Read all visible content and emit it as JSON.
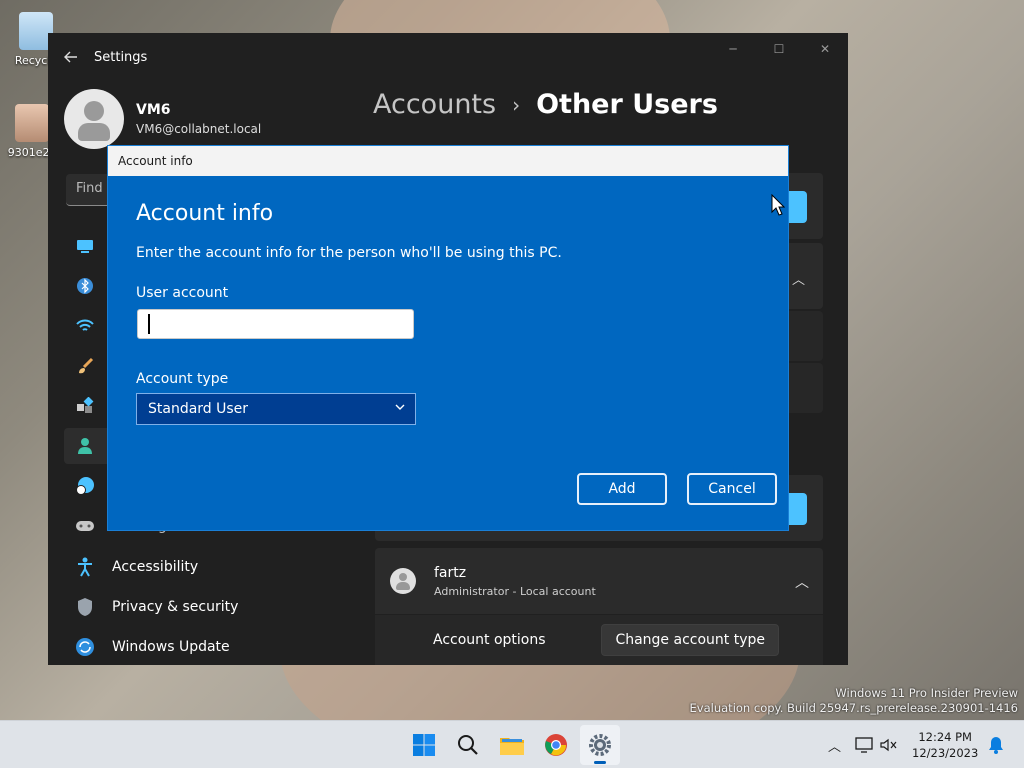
{
  "desktop": {
    "icons": [
      {
        "label": "Recycle"
      },
      {
        "label": "9301e2a"
      }
    ],
    "watermark": {
      "line1": "Windows 11 Pro Insider Preview",
      "line2": "Evaluation copy. Build 25947.rs_prerelease.230901-1416"
    }
  },
  "settings": {
    "title": "Settings",
    "profile": {
      "name": "VM6",
      "email": "VM6@collabnet.local"
    },
    "search": {
      "placeholder": "Find a"
    },
    "breadcrumb": {
      "parent": "Accounts",
      "separator": "›",
      "current": "Other Users"
    },
    "nav": [
      {
        "label": "",
        "icon": "system-icon"
      },
      {
        "label": "",
        "icon": "bluetooth-icon"
      },
      {
        "label": "",
        "icon": "wifi-icon"
      },
      {
        "label": "",
        "icon": "personalization-brush-icon"
      },
      {
        "label": "",
        "icon": "apps-icon"
      },
      {
        "label": "",
        "icon": "accounts-person-icon",
        "active": true
      },
      {
        "label": "",
        "icon": "time-language-icon"
      },
      {
        "label": "Gaming",
        "icon": "gamepad-icon"
      },
      {
        "label": "Accessibility",
        "icon": "accessibility-icon"
      },
      {
        "label": "Privacy & security",
        "icon": "shield-icon"
      },
      {
        "label": "Windows Update",
        "icon": "windows-update-icon"
      }
    ],
    "users": [
      {
        "name": "fartz",
        "detail": "Administrator - Local account",
        "options_label": "Account options",
        "change_button": "Change account type"
      }
    ]
  },
  "dialog": {
    "window_title": "Account info",
    "heading": "Account info",
    "description": "Enter the account info for the person who'll be using this PC.",
    "user_account_label": "User account",
    "user_account_value": "",
    "account_type_label": "Account type",
    "account_type_value": "Standard User",
    "add_button": "Add",
    "cancel_button": "Cancel"
  },
  "taskbar": {
    "apps": [
      "start-icon",
      "search-icon",
      "file-explorer-icon",
      "chrome-icon",
      "settings-icon"
    ],
    "active_app": "settings-icon",
    "clock": {
      "time": "12:24 PM",
      "date": "12/23/2023"
    }
  },
  "colors": {
    "dialog_blue": "#0067c0",
    "accent": "#4cc2ff",
    "window_bg": "#202020"
  }
}
